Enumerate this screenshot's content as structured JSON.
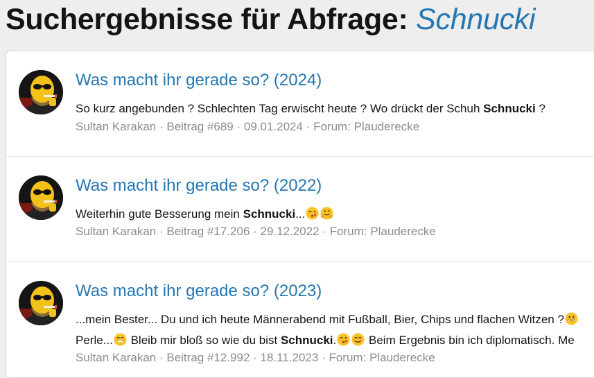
{
  "header": {
    "title_prefix": "Suchergebnisse für Abfrage:",
    "query": "Schnucki"
  },
  "colors": {
    "link": "#2577b1",
    "meta": "#8c8c8c",
    "text": "#141414"
  },
  "results": [
    {
      "title": "Was macht ihr gerade so? (2024)",
      "snippet_before": "So kurz angebunden ? Schlechten Tag erwischt heute ? Wo drückt der Schuh ",
      "highlight": "Schnucki",
      "snippet_after": " ?",
      "author": "Sultan Karakan",
      "post": "Beitrag #689",
      "date": "09.01.2024",
      "forum_prefix": "Forum:",
      "forum": "Plauderecke"
    },
    {
      "title": "Was macht ihr gerade so? (2022)",
      "snippet_before": "Weiterhin gute Besserung mein ",
      "highlight": "Schnucki",
      "snippet_after": "...",
      "emojis": [
        "kissing-face-emoji",
        "hugging-face-emoji"
      ],
      "author": "Sultan Karakan",
      "post": "Beitrag #17.206",
      "date": "29.12.2022",
      "forum_prefix": "Forum:",
      "forum": "Plauderecke"
    },
    {
      "title": "Was macht ihr gerade so? (2023)",
      "line1": "...mein Bester... Du und ich heute Männerabend mit Fußball, Bier, Chips und flachen Witzen ?",
      "line2_before": "Perle...",
      "line2_mid": " Bleib mir bloß so wie du bist ",
      "highlight": "Schnucki",
      "line2_after_dot": ".",
      "line2_end": " Beim Ergebnis bin ich diplomatisch. Me",
      "author": "Sultan Karakan",
      "post": "Beitrag #12.992",
      "date": "18.11.2023",
      "forum_prefix": "Forum:",
      "forum": "Plauderecke"
    }
  ],
  "separator": " · "
}
